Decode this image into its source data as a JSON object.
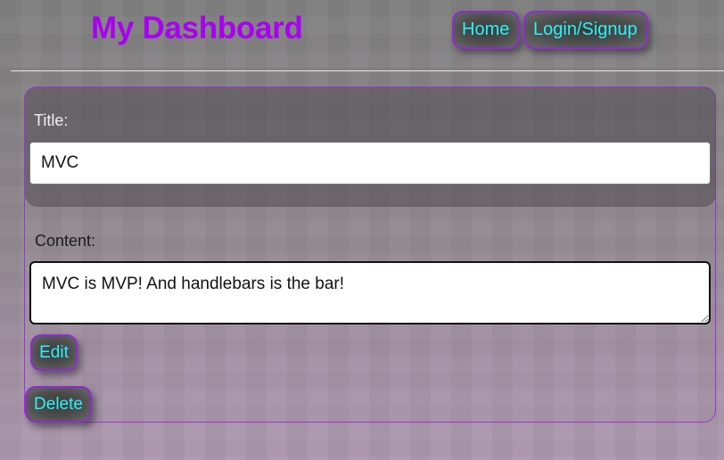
{
  "header": {
    "title": "My Dashboard",
    "nav": {
      "home_label": "Home",
      "login_label": "Login/Signup"
    }
  },
  "post_form": {
    "title_label": "Title:",
    "title_value": "MVC",
    "content_label": "Content:",
    "content_value": "MVC is MVP! And handlebars is the bar!",
    "edit_label": "Edit",
    "delete_label": "Delete"
  },
  "colors": {
    "brand_title": "#a800f0",
    "button_text": "#2af2f7",
    "button_border": "#8f2bd0"
  }
}
